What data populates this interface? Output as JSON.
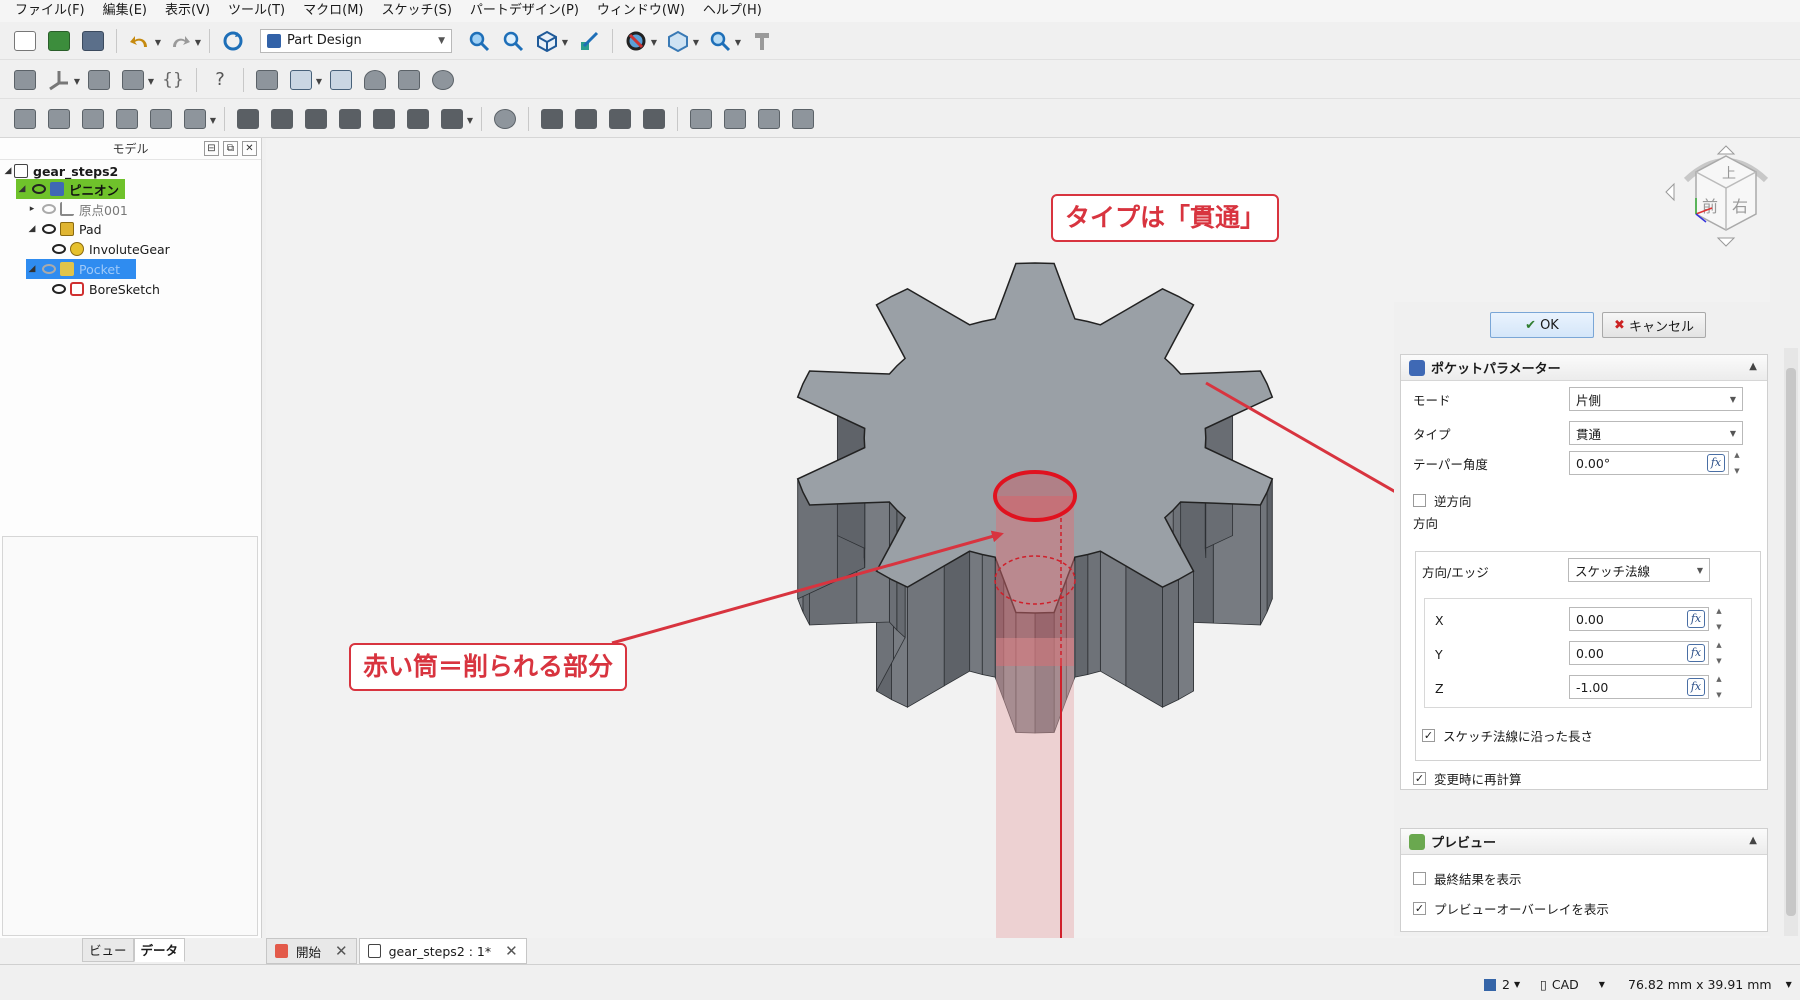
{
  "menu": [
    "ファイル(F)",
    "編集(E)",
    "表示(V)",
    "ツール(T)",
    "マクロ(M)",
    "スケッチ(S)",
    "パートデザイン(P)",
    "ウィンドウ(W)",
    "ヘルプ(H)"
  ],
  "workbench": {
    "selected": "Part Design"
  },
  "model_panel": {
    "title": "モデル",
    "tree": {
      "root": "gear_steps2",
      "body": "ピニオン",
      "origin": "原点001",
      "pad": "Pad",
      "involute_gear": "InvoluteGear",
      "pocket": "Pocket",
      "bore_sketch": "BoreSketch"
    },
    "tabs": [
      "ビュー",
      "データ"
    ]
  },
  "annotations": {
    "type_callout": "タイプは「貫通」",
    "tube_callout": "赤い筒＝削られる部分"
  },
  "nav_cube": {
    "top": "上",
    "front": "前",
    "right": "右"
  },
  "task_panel": {
    "ok": "OK",
    "cancel": "キャンセル",
    "params_title": "ポケットパラメーター",
    "mode_label": "モード",
    "mode_value": "片側",
    "type_label": "タイプ",
    "type_value": "貫通",
    "taper_label": "テーパー角度",
    "taper_value": "0.00°",
    "reversed_label": "逆方向",
    "direction_label": "方向",
    "dir_edge_label": "方向/エッジ",
    "dir_edge_value": "スケッチ法線",
    "x_label": "X",
    "x_value": "0.00",
    "y_label": "Y",
    "y_value": "0.00",
    "z_label": "Z",
    "z_value": "-1.00",
    "length_along_normal": "スケッチ法線に沿った長さ",
    "recompute_label": "変更時に再計算",
    "preview_title": "プレビュー",
    "show_final": "最終結果を表示",
    "show_overlay": "プレビューオーバーレイを表示",
    "fx": "fx"
  },
  "doc_tabs": [
    "開始",
    "gear_steps2 : 1*"
  ],
  "status": {
    "pages": "2",
    "nav_style": "CAD",
    "dimensions": "76.82 mm x 39.91 mm"
  },
  "colors": {
    "accent_red": "#d8343f",
    "tree_body_bg": "#6fc22b",
    "tree_selected_bg": "#2f8cf0",
    "gear_top": "#9aa0a6",
    "gear_side": "#6c7177"
  }
}
